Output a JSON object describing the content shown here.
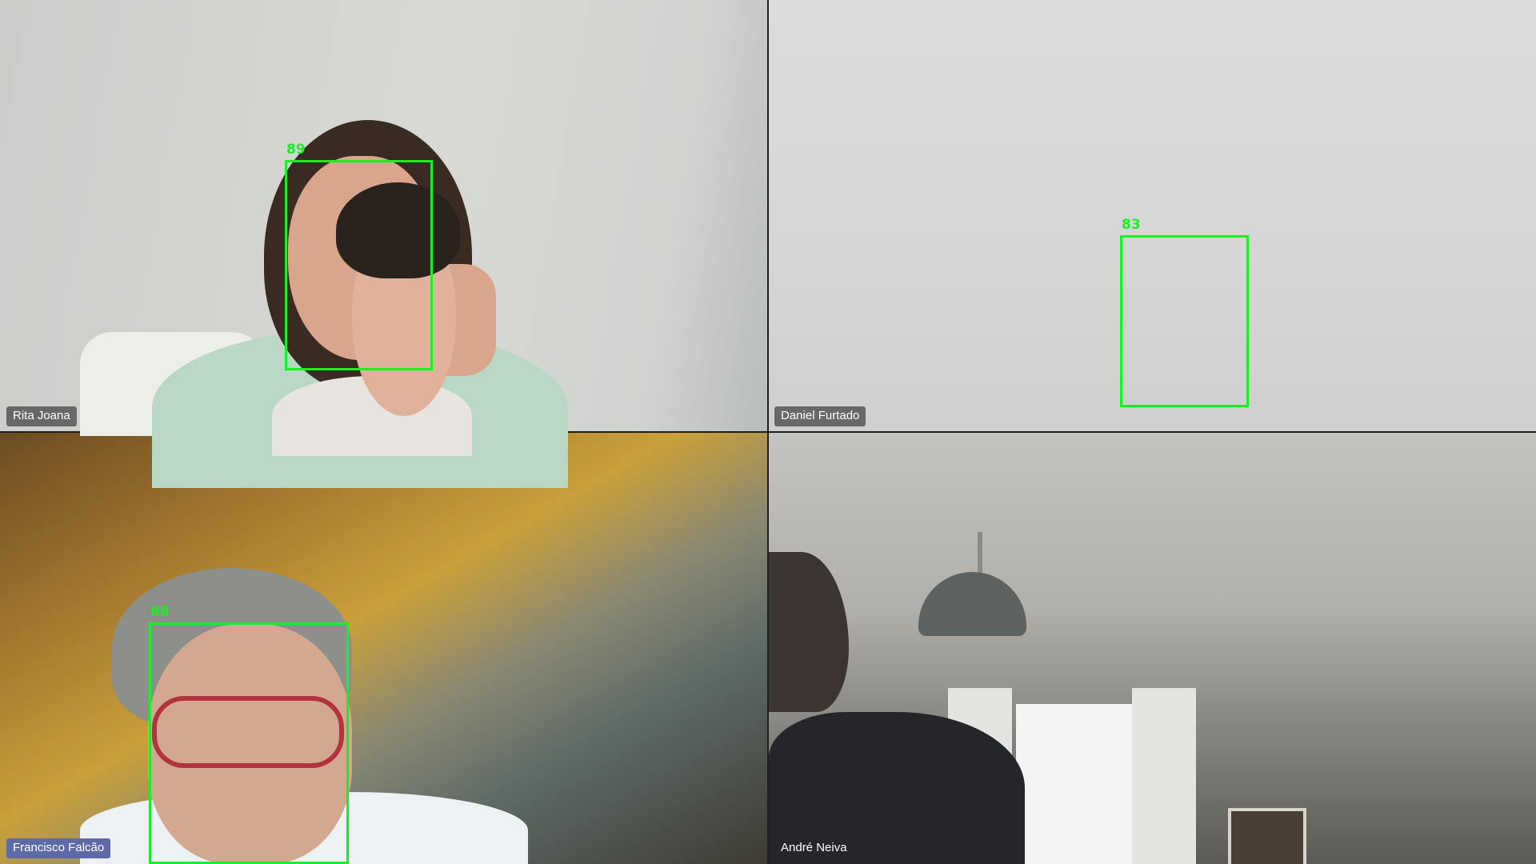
{
  "participants": [
    {
      "name": "Rita Joana",
      "face_score": "89",
      "highlighted": false
    },
    {
      "name": "Daniel Furtado",
      "face_score": "83",
      "highlighted": false
    },
    {
      "name": "Francisco Falcão",
      "face_score": "88",
      "highlighted": true
    },
    {
      "name": "André Neiva",
      "face_score": "",
      "highlighted": false
    }
  ],
  "colors": {
    "detection_box": "#17f022",
    "name_label_bg": "#3a3a3a",
    "name_label_active_bg": "#5e6aa6",
    "name_label_text": "#ffffff"
  }
}
